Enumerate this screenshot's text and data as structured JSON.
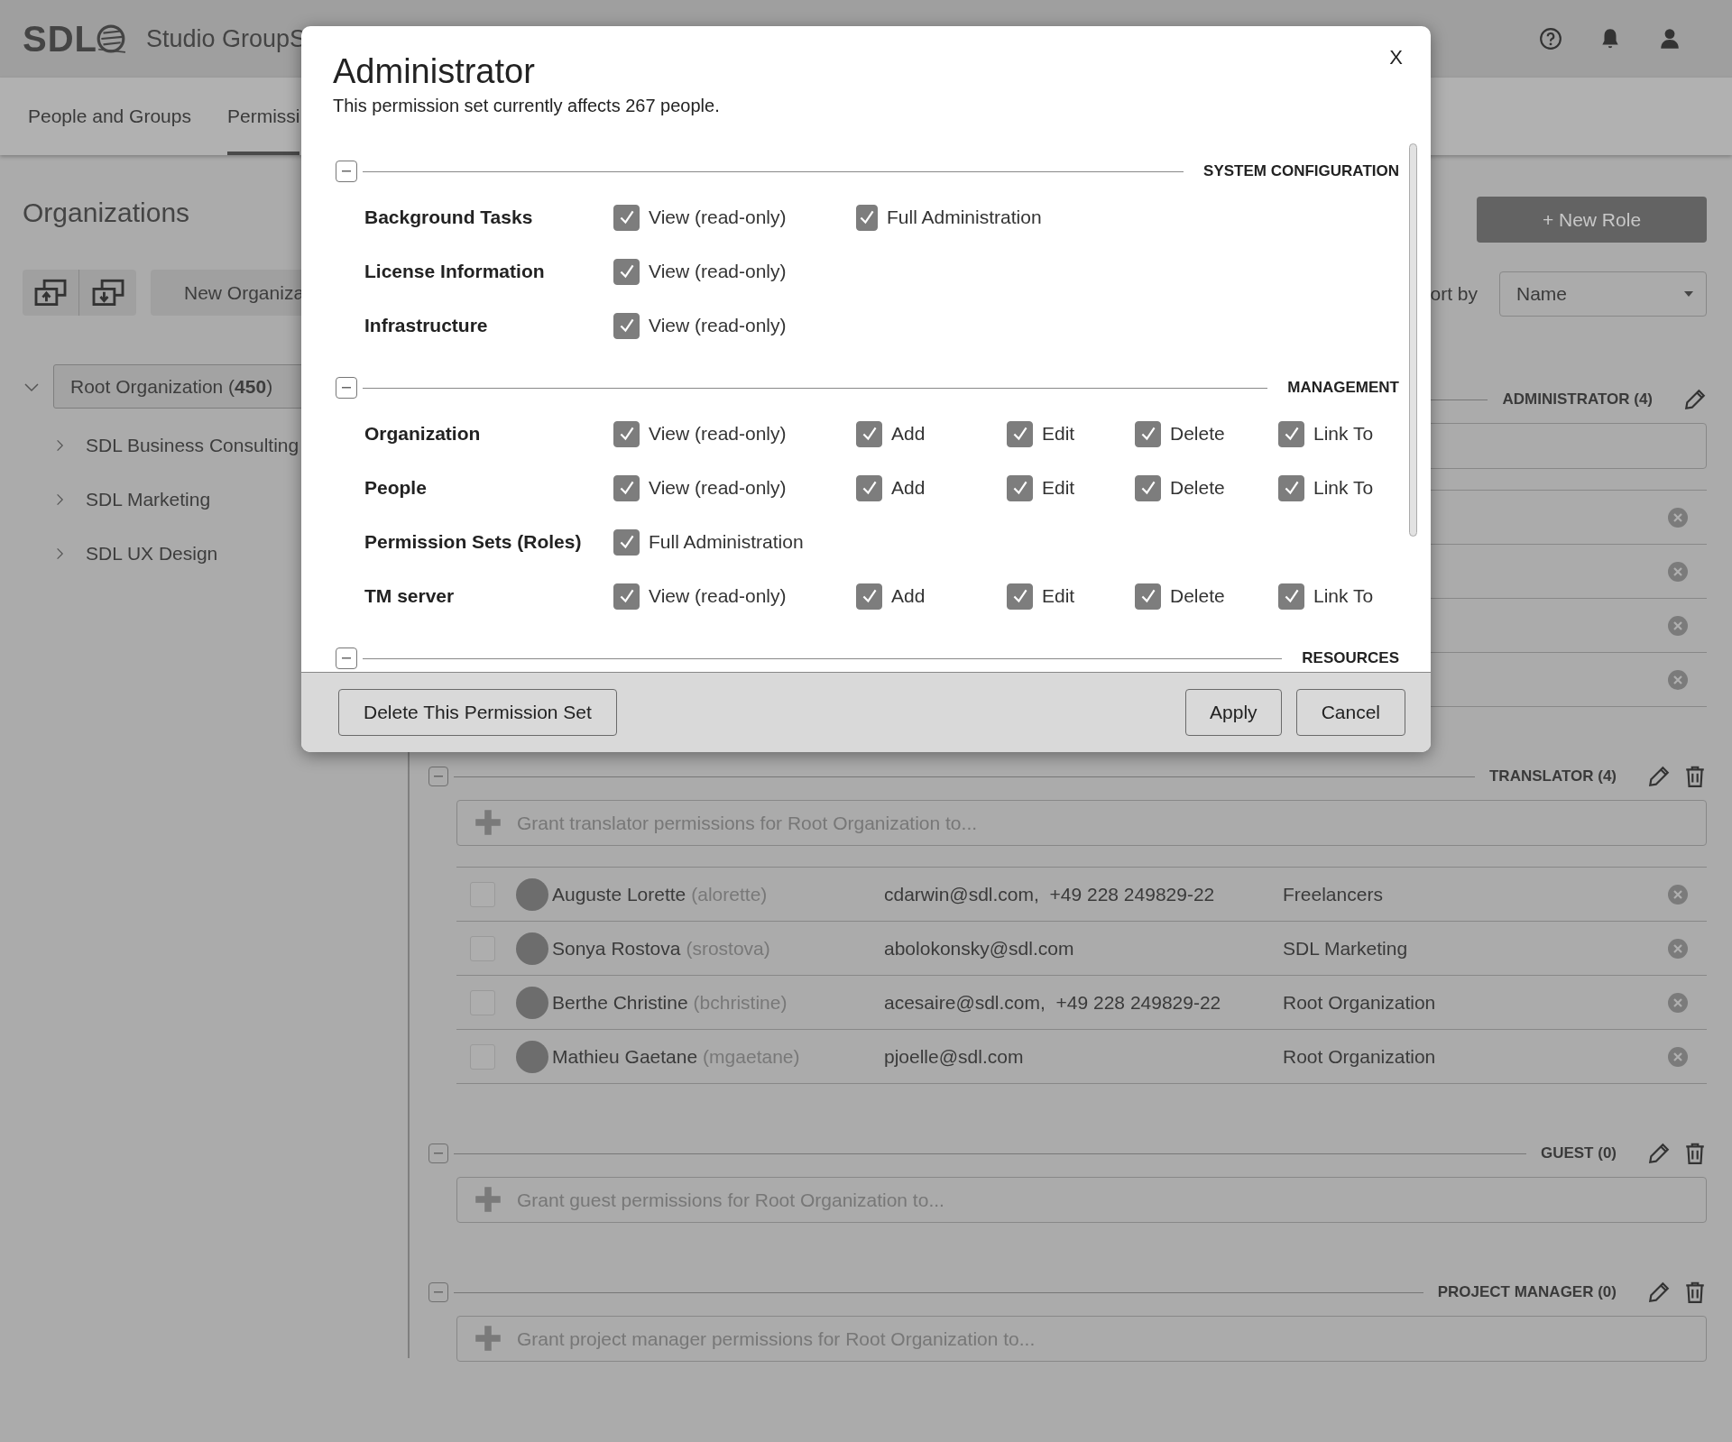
{
  "header": {
    "logo": "SDL",
    "app_name": "Studio GroupS"
  },
  "tabs": [
    {
      "label": "People and Groups",
      "selected": false
    },
    {
      "label": "Permissi",
      "selected": true
    }
  ],
  "sidebar": {
    "title": "Organizations",
    "new_button": "New Organiza",
    "tree": [
      {
        "label": "Root Organization (**450**)",
        "expanded": true,
        "selected": true,
        "children": [
          {
            "label": "SDL Business Consulting",
            "expanded": false,
            "selected": false
          },
          {
            "label": "SDL Marketing",
            "expanded": false,
            "selected": false
          },
          {
            "label": "SDL UX Design",
            "expanded": false,
            "selected": false
          }
        ]
      }
    ]
  },
  "main": {
    "new_role": "+ New Role",
    "sort_label": "ort by",
    "sort_value": "Name",
    "roles": [
      {
        "title": "ADMINISTRATOR (4)",
        "deletable": false,
        "members": [
          {
            "kind": "obscured"
          },
          {
            "kind": "obscured"
          },
          {
            "kind": "obscured"
          },
          {
            "kind": "obscured"
          }
        ]
      },
      {
        "title": "TRANSLATOR (4)",
        "expanded": true,
        "deletable": true,
        "grant_placeholder": "Grant translator permissions for Root Organization to...",
        "members": [
          {
            "kind": "user",
            "checked": false,
            "name": "Auguste Lorette",
            "username": "(alorette)",
            "contact": "cdarwin@sdl.com,  +49 228 249829-22",
            "group": "Freelancers"
          },
          {
            "kind": "user",
            "checked": false,
            "name": "Sonya Rostova",
            "username": "(srostova)",
            "contact": "abolokonsky@sdl.com",
            "group": "SDL Marketing"
          },
          {
            "kind": "user",
            "checked": false,
            "name": "Berthe Christine",
            "username": "(bchristine)",
            "contact": "acesaire@sdl.com,  +49 228 249829-22",
            "group": "Root Organization"
          },
          {
            "kind": "user",
            "checked": false,
            "name": "Mathieu Gaetane",
            "username": "(mgaetane)",
            "contact": "pjoelle@sdl.com",
            "group": "Root Organization"
          }
        ]
      },
      {
        "title": "GUEST (0)",
        "expanded": true,
        "deletable": true,
        "grant_placeholder": "Grant guest permissions for Root Organization to..."
      },
      {
        "title": "PROJECT MANAGER (0)",
        "expanded": true,
        "deletable": true,
        "grant_placeholder": "Grant project manager permissions for Root Organization to..."
      }
    ]
  },
  "dialog": {
    "title": "Administrator",
    "subtitle": "This permission set currently affects 267 people.",
    "close": "X",
    "sections": [
      {
        "title": "SYSTEM CONFIGURATION",
        "expanded": true,
        "rows": [
          {
            "label": "Background Tasks",
            "permissions": [
              {
                "label": "View (read-only)",
                "checked": true
              },
              {
                "label": "Full Administration",
                "checked": true
              }
            ]
          },
          {
            "label": "License Information",
            "permissions": [
              {
                "label": "View (read-only)",
                "checked": true
              }
            ]
          },
          {
            "label": "Infrastructure",
            "permissions": [
              {
                "label": "View (read-only)",
                "checked": true
              }
            ]
          }
        ]
      },
      {
        "title": "MANAGEMENT",
        "expanded": true,
        "rows": [
          {
            "label": "Organization",
            "permissions": [
              {
                "label": "View (read-only)",
                "checked": true
              },
              {
                "label": "Add",
                "checked": true
              },
              {
                "label": "Edit",
                "checked": true
              },
              {
                "label": "Delete",
                "checked": true
              },
              {
                "label": "Link To",
                "checked": true
              }
            ]
          },
          {
            "label": "People",
            "permissions": [
              {
                "label": "View (read-only)",
                "checked": true
              },
              {
                "label": "Add",
                "checked": true
              },
              {
                "label": "Edit",
                "checked": true
              },
              {
                "label": "Delete",
                "checked": true
              },
              {
                "label": "Link To",
                "checked": true
              }
            ]
          },
          {
            "label": "Permission Sets (Roles)",
            "permissions": [
              {
                "label": "Full Administration",
                "checked": true
              }
            ]
          },
          {
            "label": "TM server",
            "permissions": [
              {
                "label": "View (read-only)",
                "checked": true
              },
              {
                "label": "Add",
                "checked": true
              },
              {
                "label": "Edit",
                "checked": true
              },
              {
                "label": "Delete",
                "checked": true
              },
              {
                "label": "Link To",
                "checked": true
              }
            ]
          }
        ]
      },
      {
        "title": "RESOURCES",
        "expanded": true
      }
    ],
    "buttons": {
      "delete": "Delete This Permission Set",
      "apply": "Apply",
      "cancel": "Cancel"
    }
  }
}
